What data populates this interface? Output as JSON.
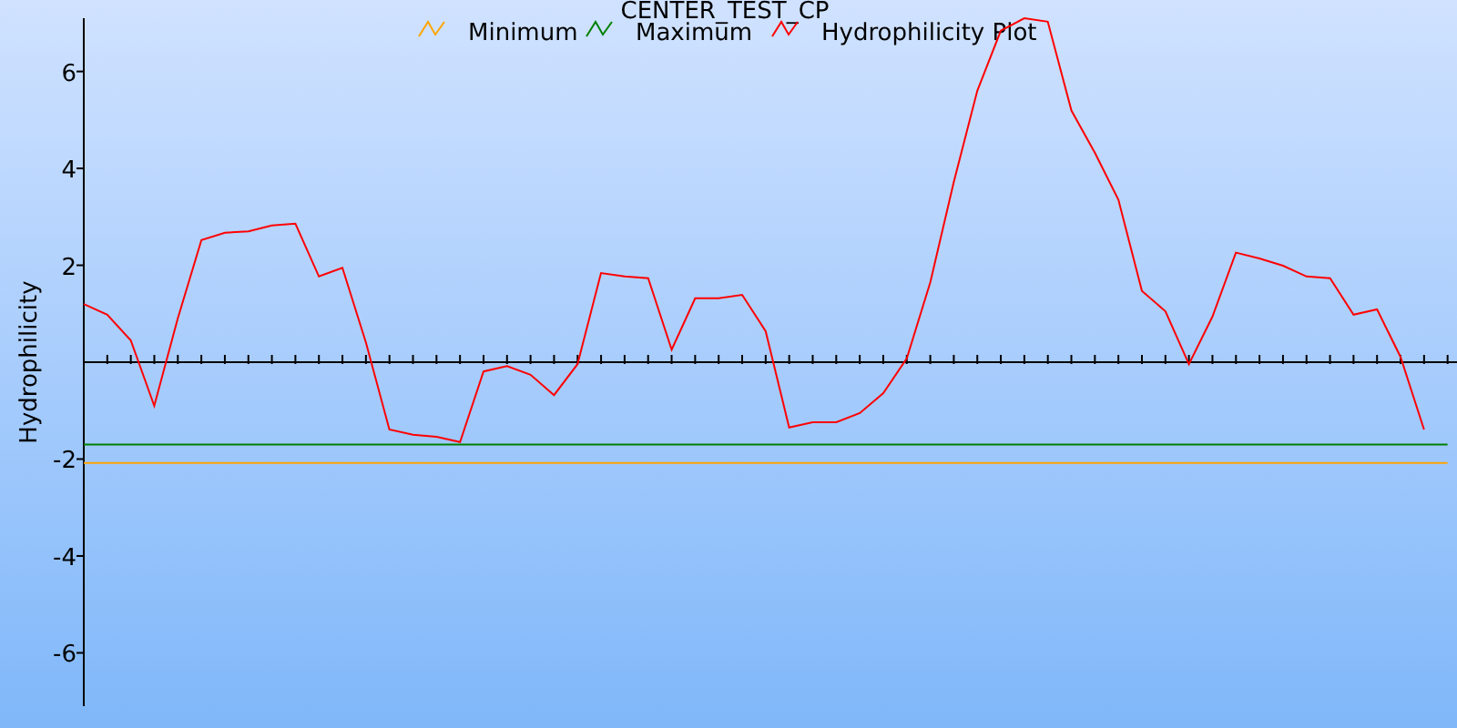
{
  "chart_data": {
    "type": "line",
    "title": "CENTER_TEST_CP",
    "ylabel": "Hydrophilicity",
    "legend": "top",
    "ylim": [
      -7.1,
      7.1
    ],
    "yticks": [
      -6,
      -4,
      -2,
      2,
      4,
      6
    ],
    "categories": [
      null,
      null,
      null,
      null,
      null,
      null,
      null,
      null,
      null,
      null,
      null,
      null,
      null,
      null,
      null,
      null,
      null,
      null,
      null,
      null,
      null,
      null,
      null,
      null,
      null,
      null,
      null,
      null,
      null,
      null,
      null,
      null,
      null,
      null,
      null,
      null,
      null,
      null,
      null,
      null,
      null,
      null,
      null,
      null,
      null,
      null,
      null,
      null,
      null,
      null,
      null,
      null,
      null,
      null,
      null,
      null,
      null,
      null,
      null
    ],
    "series": [
      {
        "name": "Minimum",
        "color": "#ffa500",
        "values": [
          -2.08,
          -2.08,
          -2.08,
          -2.08,
          -2.08,
          -2.08,
          -2.08,
          -2.08,
          -2.08,
          -2.08,
          -2.08,
          -2.08,
          -2.08,
          -2.08,
          -2.08,
          -2.08,
          -2.08,
          -2.08,
          -2.08,
          -2.08,
          -2.08,
          -2.08,
          -2.08,
          -2.08,
          -2.08,
          -2.08,
          -2.08,
          -2.08,
          -2.08,
          -2.08,
          -2.08,
          -2.08,
          -2.08,
          -2.08,
          -2.08,
          -2.08,
          -2.08,
          -2.08,
          -2.08,
          -2.08,
          -2.08,
          -2.08,
          -2.08,
          -2.08,
          -2.08,
          -2.08,
          -2.08,
          -2.08,
          -2.08,
          -2.08,
          -2.08,
          -2.08,
          -2.08,
          -2.08,
          -2.08,
          -2.08,
          -2.08,
          -2.08,
          -2.08
        ]
      },
      {
        "name": "Maximum",
        "color": "#008000",
        "values": [
          -1.7,
          -1.7,
          -1.7,
          -1.7,
          -1.7,
          -1.7,
          -1.7,
          -1.7,
          -1.7,
          -1.7,
          -1.7,
          -1.7,
          -1.7,
          -1.7,
          -1.7,
          -1.7,
          -1.7,
          -1.7,
          -1.7,
          -1.7,
          -1.7,
          -1.7,
          -1.7,
          -1.7,
          -1.7,
          -1.7,
          -1.7,
          -1.7,
          -1.7,
          -1.7,
          -1.7,
          -1.7,
          -1.7,
          -1.7,
          -1.7,
          -1.7,
          -1.7,
          -1.7,
          -1.7,
          -1.7,
          -1.7,
          -1.7,
          -1.7,
          -1.7,
          -1.7,
          -1.7,
          -1.7,
          -1.7,
          -1.7,
          -1.7,
          -1.7,
          -1.7,
          -1.7,
          -1.7,
          -1.7,
          -1.7,
          -1.7,
          -1.7,
          -1.7
        ]
      },
      {
        "name": "Hydrophilicity Plot",
        "color": "#ff0000",
        "values": [
          1.2,
          0.98,
          0.45,
          -0.9,
          0.9,
          2.52,
          2.67,
          2.7,
          2.82,
          2.86,
          1.77,
          1.95,
          0.41,
          -1.39,
          -1.5,
          -1.54,
          -1.65,
          -0.19,
          -0.08,
          -0.26,
          -0.68,
          -0.04,
          1.84,
          1.77,
          1.73,
          0.26,
          1.32,
          1.32,
          1.39,
          0.64,
          -1.35,
          -1.24,
          -1.24,
          -1.05,
          -0.64,
          0.08,
          1.65,
          3.72,
          5.6,
          6.84,
          7.1,
          7.03,
          5.19,
          4.32,
          3.35,
          1.47,
          1.05,
          -0.04,
          0.94,
          2.26,
          2.14,
          1.99,
          1.77,
          1.73,
          0.98,
          1.09,
          0.11,
          -1.39,
          null
        ]
      }
    ]
  }
}
